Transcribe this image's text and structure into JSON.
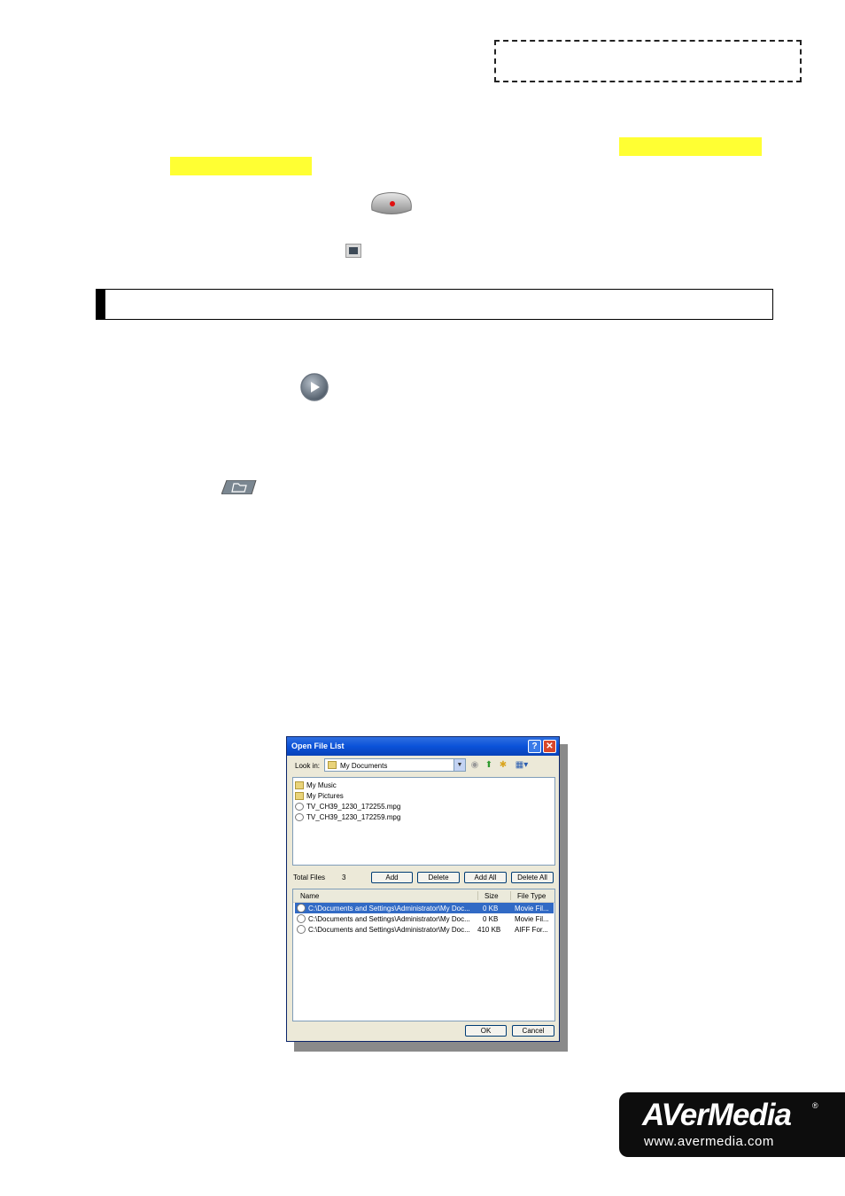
{
  "dialog": {
    "title": "Open File List",
    "help_glyph": "?",
    "close_glyph": "✕",
    "look_in_label": "Look in:",
    "look_in_value": "My Documents",
    "browser_items": [
      {
        "name": "My Music",
        "icon": "folder-icon"
      },
      {
        "name": "My Pictures",
        "icon": "folder-icon"
      },
      {
        "name": "TV_CH39_1230_172255.mpg",
        "icon": "media-file-icon"
      },
      {
        "name": "TV_CH39_1230_172259.mpg",
        "icon": "media-file-icon"
      }
    ],
    "total_files_label": "Total Files",
    "total_files_value": "3",
    "buttons": {
      "add": "Add",
      "delete": "Delete",
      "add_all": "Add All",
      "delete_all": "Delete All",
      "ok": "OK",
      "cancel": "Cancel"
    },
    "columns": [
      "Name",
      "Size",
      "File Type"
    ],
    "rows": [
      {
        "name": "C:\\Documents and Settings\\Administrator\\My Doc...",
        "size": "0 KB",
        "type": "Movie Fil...",
        "selected": true
      },
      {
        "name": "C:\\Documents and Settings\\Administrator\\My Doc...",
        "size": "0 KB",
        "type": "Movie Fil...",
        "selected": false
      },
      {
        "name": "C:\\Documents and Settings\\Administrator\\My Doc...",
        "size": "410 KB",
        "type": "AIFF For...",
        "selected": false
      }
    ]
  },
  "logo": {
    "brand": "AVerMedia",
    "reg_mark": "®",
    "url": "www.avermedia.com"
  },
  "colors": {
    "highlight": "#ffff33",
    "title_bar": "#0a52d9",
    "selection": "#316ac5",
    "record_dot": "#e01010"
  }
}
